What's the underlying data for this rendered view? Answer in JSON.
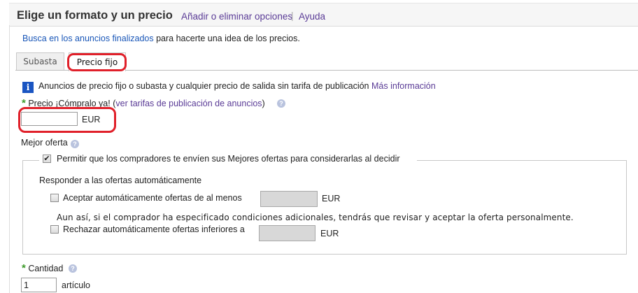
{
  "header": {
    "title": "Elige un formato y un precio",
    "add_remove_link": "Añadir o eliminar opciones",
    "separator": "|",
    "help_link": "Ayuda"
  },
  "hint": {
    "link": "Busca en los anuncios finalizados",
    "text": "para hacerte una idea de los precios."
  },
  "tabs": [
    {
      "label": "Subasta",
      "active": false
    },
    {
      "label": "Precio fijo",
      "active": true
    }
  ],
  "info": {
    "icon": "i",
    "text": "Anuncios de precio fijo o subasta y cualquier precio de salida sin tarifa de publicación",
    "link": "Más información"
  },
  "price": {
    "required_mark": "*",
    "label": "Precio ¡Cómpralo ya!",
    "open_paren": "(",
    "fees_link": "ver tarifas de publicación de anuncios",
    "close_paren": ")",
    "help_icon": "?",
    "value": "",
    "currency": "EUR"
  },
  "best_offer": {
    "label": "Mejor oferta",
    "help_icon": "?",
    "allow_checkbox": {
      "checked": true,
      "check_mark": "✔",
      "label": "Permitir que los compradores te envíen sus Mejores ofertas para considerarlas al decidir"
    },
    "auto_respond_title": "Responder a las ofertas automáticamente",
    "auto_accept": {
      "checked": false,
      "label": "Aceptar automáticamente ofertas de al menos",
      "value": "",
      "currency": "EUR"
    },
    "note": "Aun así, si el comprador ha especificado condiciones adicionales, tendrás que revisar y aceptar la oferta personalmente.",
    "auto_decline": {
      "checked": false,
      "label": "Rechazar automáticamente ofertas inferiores a",
      "value": "",
      "currency": "EUR"
    }
  },
  "quantity": {
    "required_mark": "*",
    "label": "Cantidad",
    "help_icon": "?",
    "value": "1",
    "unit": "artículo"
  },
  "colors": {
    "link_blue": "#1a57b8",
    "link_purple": "#5a3b96",
    "required_green": "#3c9a2a",
    "highlight_red": "#e0202a",
    "info_blue": "#1a55c2"
  }
}
